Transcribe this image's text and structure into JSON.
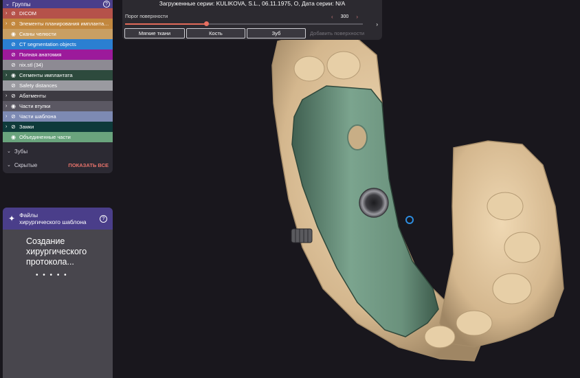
{
  "top_toolbar": {
    "series": "Загруженные серии: KULIKOVA, S.L., 06.11.1975, O, Дата серии: N/A",
    "threshold_label": "Порог поверхности",
    "threshold_value": "300",
    "threshold_fraction": 0.34,
    "buttons": [
      "Мягкие ткани",
      "Кость",
      "Зуб"
    ],
    "add_surface": "Добавить поверхности",
    "stepper_prev_icon": "chevron-left-icon",
    "stepper_next_icon": "chevron-right-icon",
    "collapse_icon": "chevron-right-icon"
  },
  "groups_panel": {
    "title": "Группы",
    "help_icon": "help-circle-icon",
    "items": [
      {
        "label": "DICOM",
        "color": "#b5524a",
        "arrow": true,
        "eye": "eye-off-icon"
      },
      {
        "label": "Элементы планирования имплантатов",
        "color": "#c2873e",
        "arrow": true,
        "eye": "eye-off-icon"
      },
      {
        "label": "Сканы челюсти",
        "color": "#c99f63",
        "arrow": false,
        "eye": "eye-icon"
      },
      {
        "label": "CT segmentation objects",
        "color": "#2b7fd1",
        "arrow": false,
        "eye": "eye-off-icon"
      },
      {
        "label": "Полная анатомия",
        "color": "#9c1a9b",
        "arrow": false,
        "eye": "eye-off-icon"
      },
      {
        "label": "nix.stl (34)",
        "color": "#8d8a93",
        "arrow": false,
        "eye": "eye-off-icon"
      },
      {
        "label": "Сегменты имплантата",
        "color": "#2d4a3d",
        "arrow": true,
        "eye": "eye-icon"
      },
      {
        "label": "Safety distances",
        "color": "#9a9aa0",
        "arrow": false,
        "eye": "eye-off-icon"
      },
      {
        "label": "Абатменты",
        "color": "#3d3b42",
        "arrow": true,
        "eye": "eye-off-icon"
      },
      {
        "label": "Части втулки",
        "color": "#5b5863",
        "arrow": true,
        "eye": "eye-icon"
      },
      {
        "label": "Части шаблона",
        "color": "#7d8ab3",
        "arrow": true,
        "eye": "eye-off-icon"
      },
      {
        "label": "Замки",
        "color": "#0e3a3a",
        "arrow": true,
        "eye": "eye-off-icon"
      },
      {
        "label": "Объединенные части",
        "color": "#6aa47d",
        "arrow": false,
        "eye": "eye-icon"
      }
    ],
    "teeth_label": "Зубы",
    "hidden_label": "Скрытые",
    "show_all": "ПОКАЗАТЬ ВСЕ"
  },
  "files_panel": {
    "title_line1": "Файлы",
    "title_line2": "хирургического шаблона",
    "wand_icon": "magic-wand-icon",
    "help_icon": "help-circle-icon",
    "progress_text": "Создание хирургического протокола...",
    "dots": "• • • •   •"
  },
  "viewport": {
    "bone_color": "#dcc39c",
    "guide_color": "#6f9581",
    "background": "#19171d"
  }
}
